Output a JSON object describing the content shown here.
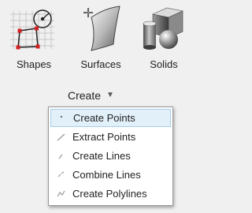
{
  "ribbon": {
    "buttons": [
      {
        "label": "Shapes",
        "icon": "shapes-icon"
      },
      {
        "label": "Surfaces",
        "icon": "surfaces-icon"
      },
      {
        "label": "Solids",
        "icon": "solids-icon"
      }
    ],
    "group_label": "Create",
    "group_caret": "▼"
  },
  "menu": {
    "items": [
      {
        "label": "Create Points",
        "icon": "point-icon",
        "highlighted": true
      },
      {
        "label": "Extract Points",
        "icon": "extract-points-icon",
        "highlighted": false
      },
      {
        "label": "Create Lines",
        "icon": "line-icon",
        "highlighted": false
      },
      {
        "label": "Combine Lines",
        "icon": "combine-lines-icon",
        "highlighted": false
      },
      {
        "label": "Create Polylines",
        "icon": "polyline-icon",
        "highlighted": false
      }
    ]
  },
  "colors": {
    "highlight_bg": "#e2f0f9",
    "highlight_border": "#a9cde6",
    "menu_border": "#9a9a9a"
  }
}
